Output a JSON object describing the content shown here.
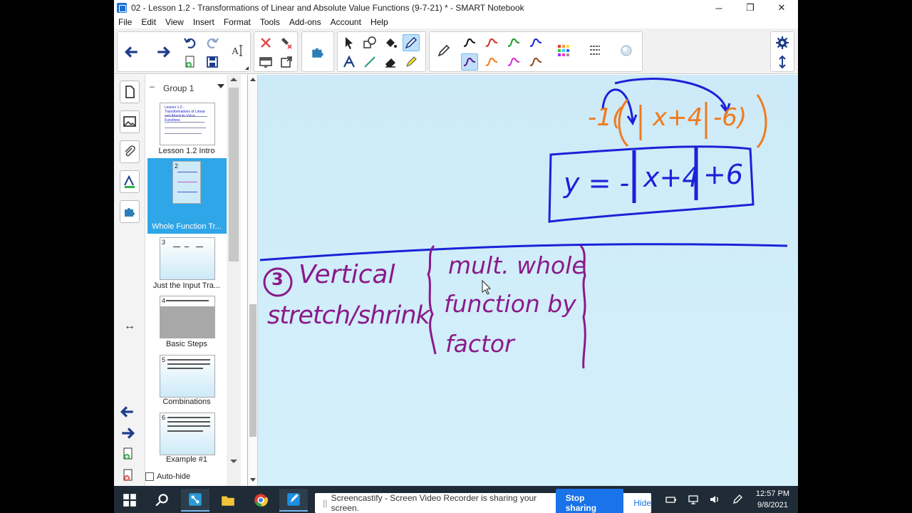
{
  "window": {
    "title": "02 - Lesson 1.2 - Transformations of Linear and Absolute Value Functions (9-7-21) * - SMART Notebook",
    "minimize": "─",
    "maximize": "❐",
    "close": "✕"
  },
  "menu": [
    "File",
    "Edit",
    "View",
    "Insert",
    "Format",
    "Tools",
    "Add-ons",
    "Account",
    "Help"
  ],
  "sorter": {
    "group": "Group 1",
    "pages": [
      {
        "num": "",
        "label": "Lesson 1.2 Intro",
        "preview": "Lesson 1.2 - Transformations of Linear and Absolute Value Functions"
      },
      {
        "num": "2",
        "label": "Whole Function Tr..."
      },
      {
        "num": "3",
        "label": "Just the Input Tra..."
      },
      {
        "num": "4",
        "label": "Basic Steps"
      },
      {
        "num": "5",
        "label": "Combinations"
      },
      {
        "num": "6",
        "label": "Example #1"
      }
    ],
    "autohide": "Auto-hide"
  },
  "board": {
    "equation_top_left": "-1(",
    "equation_top_abs": "x+4",
    "equation_top_right": "-6)",
    "boxed_prefix": "y = -",
    "boxed_abs": "x+4",
    "boxed_suffix": "+6",
    "heading_number": "3",
    "heading_line1": "Vertical",
    "heading_line2": "stretch/shrink",
    "desc_line1": "mult. whole",
    "desc_line2": "function by",
    "desc_line3": "factor"
  },
  "colors": {
    "blue_ink": "#1a22d8",
    "orange_ink": "#f07a1e",
    "purple_ink": "#8a1a8a",
    "accent": "#2ea6e8"
  },
  "taskbar": {
    "share_text": "Screencastify - Screen Video Recorder is sharing your screen.",
    "stop_label": "Stop sharing",
    "hide_label": "Hide",
    "time": "12:57 PM",
    "date": "9/8/2021"
  }
}
